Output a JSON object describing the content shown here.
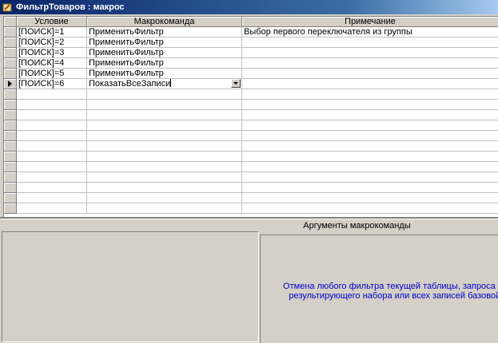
{
  "window": {
    "title": "ФильтрТоваров : макрос"
  },
  "columns": {
    "condition": "Условие",
    "action": "Макрокоманда",
    "comment": "Примечание"
  },
  "rows": [
    {
      "condition": "[ПОИСК]=1",
      "action": "ПрименитьФильтр",
      "comment": "Выбор первого переключателя из группы"
    },
    {
      "condition": "[ПОИСК]=2",
      "action": "ПрименитьФильтр",
      "comment": ""
    },
    {
      "condition": "[ПОИСК]=3",
      "action": "ПрименитьФильтр",
      "comment": ""
    },
    {
      "condition": "[ПОИСК]=4",
      "action": "ПрименитьФильтр",
      "comment": ""
    },
    {
      "condition": "[ПОИСК]=5",
      "action": "ПрименитьФильтр",
      "comment": ""
    },
    {
      "condition": "[ПОИСК]=6",
      "action": "ПоказатьВсеЗаписи",
      "comment": ""
    }
  ],
  "current_row": 5,
  "arguments": {
    "title": "Аргументы макрокоманды",
    "help_line1": "Отмена любого фильтра текущей таблицы, запроса или фор",
    "help_line2": "результирующего набора или всех записей базовой табли"
  },
  "colors": {
    "titlebar": "#0a246a",
    "help_text": "#0000cc",
    "chrome": "#d4d0c8"
  },
  "icons": {
    "app": "access-macro-icon",
    "row_pointer": "current-row-arrow-icon",
    "dropdown": "dropdown-arrow-icon"
  }
}
